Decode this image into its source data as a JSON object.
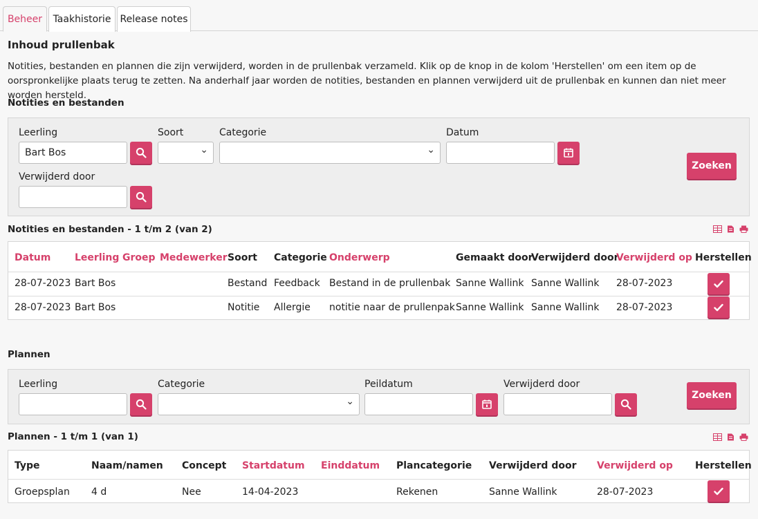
{
  "tabs": [
    {
      "label": "Beheer",
      "active": true
    },
    {
      "label": "Taakhistorie",
      "active": false
    },
    {
      "label": "Release notes",
      "active": false
    }
  ],
  "page_title": "Inhoud prullenbak",
  "intro": "Notities, bestanden en plannen die zijn verwijderd, worden in de prullenbak verzameld. Klik op de knop in de kolom 'Herstellen' om een item op de oorspronkelijke plaats terug te zetten. Na anderhalf jaar worden de notities, bestanden en plannen verwijderd uit de prullenbak en kunnen dan niet meer worden hersteld.",
  "notes": {
    "section_title": "Notities en bestanden",
    "filters": {
      "leerling_label": "Leerling",
      "leerling_value": "Bart Bos",
      "soort_label": "Soort",
      "soort_value": "",
      "categorie_label": "Categorie",
      "categorie_value": "",
      "datum_label": "Datum",
      "datum_value": "",
      "verwijderd_label": "Verwijderd door",
      "verwijderd_value": "",
      "search_button": "Zoeken"
    },
    "results_title": "Notities en bestanden - 1 t/m 2 (van 2)",
    "columns": [
      "Datum",
      "Leerling",
      "Groep",
      "Medewerker",
      "Soort",
      "Categorie",
      "Onderwerp",
      "Gemaakt door",
      "Verwijderd door",
      "Verwijderd op",
      "Herstellen"
    ],
    "rows": [
      [
        "28-07-2023",
        "Bart Bos",
        "",
        "",
        "Bestand",
        "Feedback",
        "Bestand in de prullenbak",
        "Sanne Wallink",
        "Sanne Wallink",
        "28-07-2023"
      ],
      [
        "28-07-2023",
        "Bart Bos",
        "",
        "",
        "Notitie",
        "Allergie",
        "notitie naar de prullenpak",
        "Sanne Wallink",
        "Sanne Wallink",
        "28-07-2023"
      ]
    ]
  },
  "plans": {
    "section_title": "Plannen",
    "filters": {
      "leerling_label": "Leerling",
      "leerling_value": "",
      "categorie_label": "Categorie",
      "categorie_value": "",
      "peildatum_label": "Peildatum",
      "peildatum_value": "",
      "verwijderd_label": "Verwijderd door",
      "verwijderd_value": "",
      "search_button": "Zoeken"
    },
    "results_title": "Plannen - 1 t/m 1 (van 1)",
    "columns": [
      "Type",
      "Naam/namen",
      "Concept",
      "Startdatum",
      "Einddatum",
      "Plancategorie",
      "Verwijderd door",
      "Verwijderd op",
      "Herstellen"
    ],
    "rows": [
      [
        "Groepsplan",
        "4 d",
        "Nee",
        "14-04-2023",
        "",
        "Rekenen",
        "Sanne Wallink",
        "28-07-2023"
      ]
    ]
  },
  "colors": {
    "accent": "#d6416b",
    "panel": "#eeeeee",
    "background": "#f7f7f7"
  },
  "icons": {
    "search": "search-icon",
    "calendar": "calendar-icon",
    "restore": "check-icon",
    "export_table": "table-icon",
    "export_file": "file-icon",
    "print": "print-icon"
  }
}
